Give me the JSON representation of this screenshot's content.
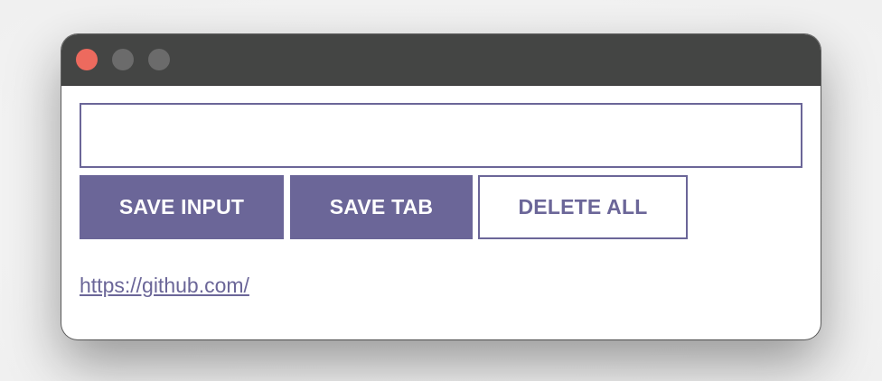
{
  "window": {
    "controls": [
      {
        "name": "close-button",
        "color": "#ed6a5e"
      },
      {
        "name": "minimize-button",
        "color": "#6b6b6b"
      },
      {
        "name": "maximize-button",
        "color": "#6b6b6b"
      }
    ]
  },
  "input": {
    "value": "",
    "placeholder": ""
  },
  "buttons": {
    "save_input": "SAVE INPUT",
    "save_tab": "SAVE TAB",
    "delete_all": "DELETE ALL"
  },
  "leads": [
    {
      "url": "https://github.com/"
    }
  ],
  "colors": {
    "accent": "#6b6698",
    "titlebar": "#444544"
  }
}
